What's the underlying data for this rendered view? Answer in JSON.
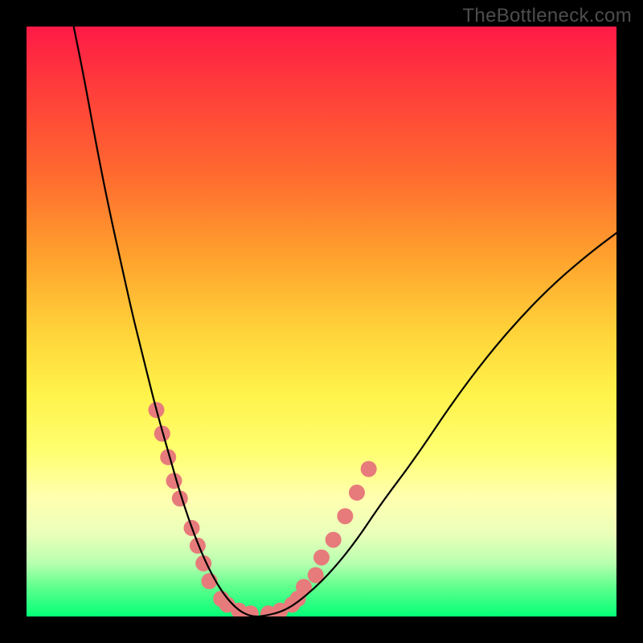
{
  "watermark": "TheBottleneck.com",
  "chart_data": {
    "type": "line",
    "title": "",
    "xlabel": "",
    "ylabel": "",
    "xlim": [
      0,
      100
    ],
    "ylim": [
      0,
      100
    ],
    "grid": false,
    "legend": false,
    "background_gradient": {
      "orientation": "vertical",
      "stops": [
        {
          "pos": 0.0,
          "color": "#ff1a47"
        },
        {
          "pos": 0.25,
          "color": "#ff6a2f"
        },
        {
          "pos": 0.52,
          "color": "#ffd43a"
        },
        {
          "pos": 0.8,
          "color": "#ffffb0"
        },
        {
          "pos": 1.0,
          "color": "#04ff77"
        }
      ]
    },
    "series": [
      {
        "name": "bottleneck-curve",
        "color": "#000000",
        "x": [
          8,
          10,
          12,
          14,
          16,
          18,
          20,
          22,
          24,
          26,
          28,
          30,
          32,
          34,
          36,
          38,
          40,
          44,
          48,
          52,
          56,
          60,
          66,
          72,
          78,
          84,
          90,
          96,
          100
        ],
        "y": [
          100,
          90,
          79,
          69,
          60,
          51,
          43,
          35,
          28,
          21,
          15,
          10,
          6,
          3,
          1,
          0,
          0,
          1,
          4,
          8,
          13,
          19,
          27,
          36,
          44,
          51,
          57,
          62,
          65
        ]
      }
    ],
    "markers": {
      "name": "highlight-dots",
      "color": "#e77b7b",
      "radius_px": 10,
      "points_xy": [
        [
          22,
          35
        ],
        [
          23,
          31
        ],
        [
          24,
          27
        ],
        [
          25,
          23
        ],
        [
          26,
          20
        ],
        [
          28,
          15
        ],
        [
          29,
          12
        ],
        [
          30,
          9
        ],
        [
          31,
          6
        ],
        [
          33,
          3
        ],
        [
          34,
          2
        ],
        [
          36,
          1
        ],
        [
          38,
          0.5
        ],
        [
          41,
          0.5
        ],
        [
          43,
          1
        ],
        [
          45,
          2
        ],
        [
          46,
          3
        ],
        [
          47,
          5
        ],
        [
          49,
          7
        ],
        [
          50,
          10
        ],
        [
          52,
          13
        ],
        [
          54,
          17
        ],
        [
          56,
          21
        ],
        [
          58,
          25
        ]
      ]
    }
  }
}
